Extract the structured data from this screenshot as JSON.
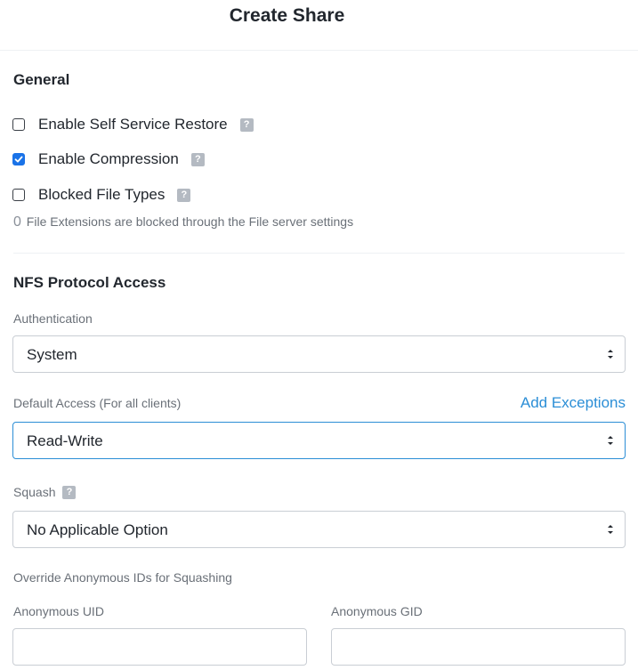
{
  "header": {
    "title": "Create Share"
  },
  "general": {
    "title": "General",
    "options": [
      {
        "label": "Enable Self Service Restore",
        "checked": false,
        "help_icon": "help-icon"
      },
      {
        "label": "Enable Compression",
        "checked": true,
        "help_icon": "help-icon"
      },
      {
        "label": "Blocked File Types",
        "checked": false,
        "help_icon": "help-icon"
      }
    ],
    "blocked_count": "0",
    "blocked_note": "File Extensions are blocked through the File server settings"
  },
  "nfs": {
    "title": "NFS Protocol Access",
    "authentication": {
      "label": "Authentication",
      "value": "System"
    },
    "default_access": {
      "label": "Default Access (For all clients)",
      "value": "Read-Write",
      "add_exceptions": "Add Exceptions"
    },
    "squash": {
      "label": "Squash",
      "value": "No Applicable Option"
    },
    "override_label": "Override Anonymous IDs for Squashing",
    "anonymous_uid": {
      "label": "Anonymous UID",
      "value": "",
      "placeholder": ""
    },
    "anonymous_gid": {
      "label": "Anonymous GID",
      "value": "",
      "placeholder": ""
    }
  },
  "colors": {
    "accent": "#2b8ed6",
    "checkbox_checked": "#1a73e8",
    "help_icon_bg": "#b4bac2",
    "muted_text": "#6a7078"
  },
  "icons": {
    "help": "question-mark",
    "select_arrows": "up-down-chevrons",
    "checkmark": "check"
  }
}
